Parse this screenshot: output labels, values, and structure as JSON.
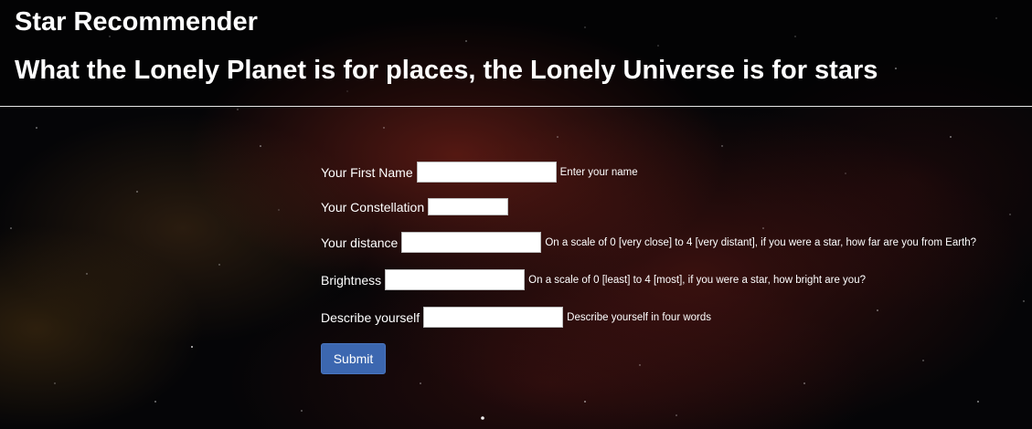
{
  "header": {
    "title": "Star Recommender",
    "subtitle": "What the Lonely Planet is for places, the Lonely Universe is for stars"
  },
  "form": {
    "first_name": {
      "label": "Your First Name",
      "value": "",
      "hint": "Enter your name"
    },
    "constellation": {
      "label": "Your Constellation",
      "value": "",
      "hint": ""
    },
    "distance": {
      "label": "Your distance",
      "value": "",
      "hint": "On a scale of 0 [very close] to 4 [very distant], if you were a star, how far are you from Earth?"
    },
    "brightness": {
      "label": "Brightness",
      "value": "",
      "hint": "On a scale of 0 [least] to 4 [most], if you were a star, how bright are you?"
    },
    "describe": {
      "label": "Describe yourself",
      "value": "",
      "hint": "Describe yourself in four words"
    },
    "submit_label": "Submit"
  },
  "colors": {
    "background": "#050507",
    "nebula": "#96281c",
    "button": "#3c67b0",
    "text": "#ffffff"
  }
}
